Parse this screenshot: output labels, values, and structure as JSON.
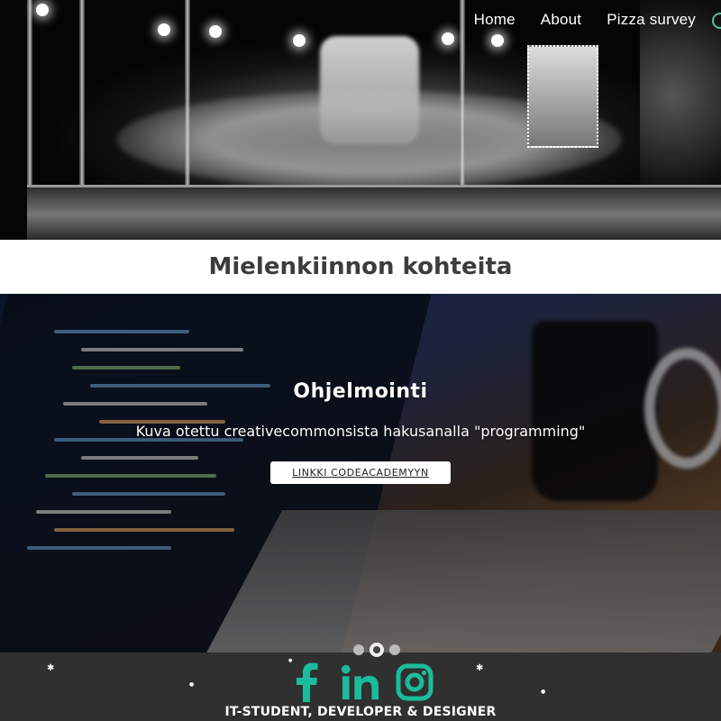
{
  "nav": {
    "items": [
      {
        "label": "Home"
      },
      {
        "label": "About"
      },
      {
        "label": "Pizza survey"
      }
    ]
  },
  "section": {
    "title": "Mielenkiinnon kohteita"
  },
  "carousel": {
    "slide": {
      "heading": "Ohjelmointi",
      "text": "Kuva otettu creativecommonsista hakusanalla \"programming\"",
      "button_label": "LINKKI CODEACADEMYYN"
    },
    "indicators": 3,
    "active_index": 1
  },
  "footer": {
    "socials": [
      {
        "icon": "facebook-icon"
      },
      {
        "icon": "linkedin-icon"
      },
      {
        "icon": "instagram-icon"
      }
    ],
    "tagline": "IT-STUDENT, DEVELOPER & DESIGNER",
    "icon_color": "#1abc9c",
    "background": "#303030"
  }
}
